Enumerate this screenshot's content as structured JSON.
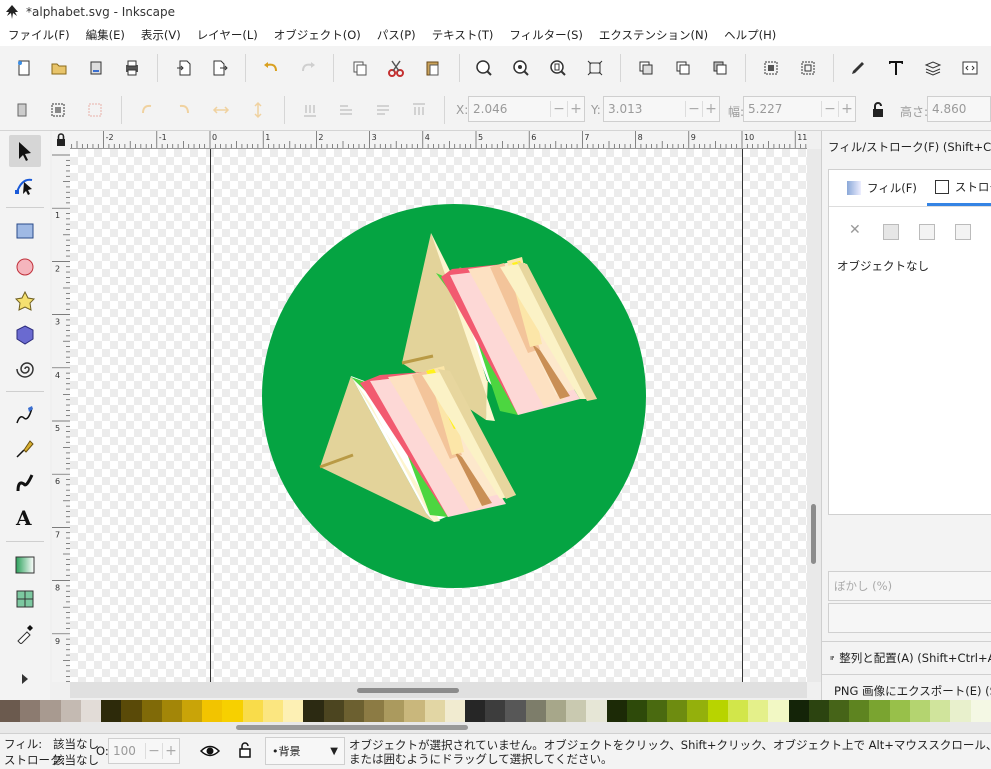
{
  "window": {
    "title": "*alphabet.svg - Inkscape"
  },
  "menu": [
    "ファイル(F)",
    "編集(E)",
    "表示(V)",
    "レイヤー(L)",
    "オブジェクト(O)",
    "パス(P)",
    "テキスト(T)",
    "フィルター(S)",
    "エクステンション(N)",
    "ヘルプ(H)"
  ],
  "controls": {
    "x_label": "X:",
    "x_value": "2.046",
    "y_label": "Y:",
    "y_value": "3.013",
    "w_label": "幅:",
    "w_value": "5.227",
    "h_label": "高さ:",
    "h_value": "4.860"
  },
  "ruler_h_ticks": [
    "-2",
    "-1",
    "0",
    "1",
    "2",
    "3",
    "4",
    "5",
    "6",
    "7",
    "8",
    "9",
    "10",
    "11"
  ],
  "ruler_v_ticks": [
    "1",
    "2",
    "3",
    "4",
    "5",
    "6",
    "7",
    "8",
    "9"
  ],
  "dock": {
    "fill_stroke_title": "フィル/ストローク(F) (Shift+Ctrl+F)",
    "tab_fill": "フィル(F)",
    "tab_stroke": "ストローク",
    "no_object": "オブジェクトなし",
    "blur_label": "ぼかし (%)",
    "align_title": "整列と配置(A) (Shift+Ctrl+A)",
    "export_title": "PNG 画像にエクスポート(E) (Shift+Ctrl+E)"
  },
  "palette": [
    "#6b5a4e",
    "#8c7b70",
    "#a89a90",
    "#c4bab2",
    "#e2dcd7",
    "#2d2a0a",
    "#5a4a08",
    "#806a08",
    "#a38608",
    "#c9a408",
    "#f2c400",
    "#f7d000",
    "#f9dc4a",
    "#fbe680",
    "#fdf0b4",
    "#2c2a12",
    "#4c4520",
    "#6c6030",
    "#8c7b44",
    "#ab9a5e",
    "#c9b77c",
    "#e2d6a4",
    "#f1ebd0",
    "#262626",
    "#3d3d3d",
    "#575757",
    "#7d7d6a",
    "#a7a78a",
    "#c9c9b0",
    "#e6e6d6",
    "#1c2a06",
    "#2e4a0a",
    "#4a6a10",
    "#6e8c10",
    "#94b00c",
    "#b8d400",
    "#d2e64a",
    "#e4f08a",
    "#f2f8c4",
    "#142408",
    "#2c4410",
    "#466418",
    "#5e8420",
    "#7aa430",
    "#98c04a",
    "#b4d470",
    "#d0e49c",
    "#e8f0cc",
    "#f4f8e4"
  ],
  "status": {
    "fill_label": "フィル:",
    "fill_value": "該当なし",
    "stroke_label": "ストローク:",
    "stroke_value": "該当なし",
    "opacity_label": "O:",
    "opacity_value": "100",
    "layer": "•背景",
    "message_line1": "オブジェクトが選択されていません。オブジェクトをクリック、Shift+クリック、オブジェクト上で Alt+マウススクロール、",
    "message_line2": "または囲むようにドラッグして選択してください。"
  }
}
